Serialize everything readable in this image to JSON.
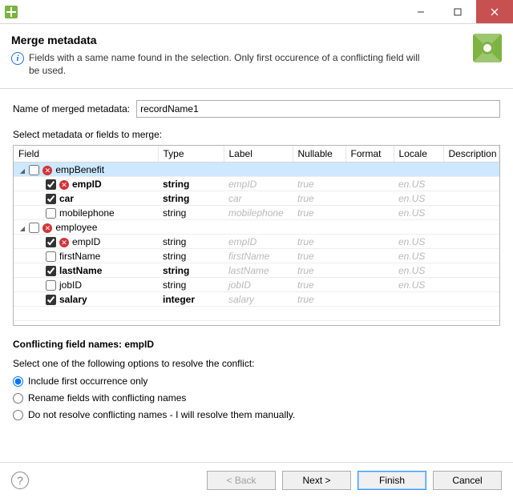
{
  "titlebar": {
    "title": ""
  },
  "banner": {
    "heading": "Merge metadata",
    "info": "Fields with a same name found in the selection. Only first occurence of a conflicting field will be used."
  },
  "nameField": {
    "label": "Name of merged metadata:",
    "value": "recordName1"
  },
  "selectLabel": "Select metadata or fields to merge:",
  "columns": {
    "field": "Field",
    "type": "Type",
    "label": "Label",
    "nullable": "Nullable",
    "format": "Format",
    "locale": "Locale",
    "description": "Description"
  },
  "groups": [
    {
      "name": "empBenefit",
      "checked": false,
      "conflict": true,
      "expanded": true,
      "selected": true,
      "children": [
        {
          "name": "empID",
          "type": "string",
          "label": "empID",
          "nullable": "true",
          "format": "",
          "locale": "en.US",
          "checked": true,
          "conflict": true,
          "bold": true
        },
        {
          "name": "car",
          "type": "string",
          "label": "car",
          "nullable": "true",
          "format": "",
          "locale": "en.US",
          "checked": true,
          "conflict": false,
          "bold": true
        },
        {
          "name": "mobilephone",
          "type": "string",
          "label": "mobilephone",
          "nullable": "true",
          "format": "",
          "locale": "en.US",
          "checked": false,
          "conflict": false,
          "bold": false
        }
      ]
    },
    {
      "name": "employee",
      "checked": false,
      "conflict": true,
      "expanded": true,
      "selected": false,
      "children": [
        {
          "name": "empID",
          "type": "string",
          "label": "empID",
          "nullable": "true",
          "format": "",
          "locale": "en.US",
          "checked": true,
          "conflict": true,
          "bold": false
        },
        {
          "name": "firstName",
          "type": "string",
          "label": "firstName",
          "nullable": "true",
          "format": "",
          "locale": "en.US",
          "checked": false,
          "conflict": false,
          "bold": false
        },
        {
          "name": "lastName",
          "type": "string",
          "label": "lastName",
          "nullable": "true",
          "format": "",
          "locale": "en.US",
          "checked": true,
          "conflict": false,
          "bold": true
        },
        {
          "name": "jobID",
          "type": "string",
          "label": "jobID",
          "nullable": "true",
          "format": "",
          "locale": "en.US",
          "checked": false,
          "conflict": false,
          "bold": false
        },
        {
          "name": "salary",
          "type": "integer",
          "label": "salary",
          "nullable": "true",
          "format": "",
          "locale": "",
          "checked": true,
          "conflict": false,
          "bold": true
        }
      ]
    }
  ],
  "conflict": {
    "title": "Conflicting field names: empID",
    "prompt": "Select one of the following options to resolve the conflict:",
    "options": [
      {
        "label": "Include first occurrence only",
        "checked": true
      },
      {
        "label": "Rename fields with conflicting names",
        "checked": false
      },
      {
        "label": "Do not resolve conflicting names - I will resolve them manually.",
        "checked": false
      }
    ]
  },
  "buttons": {
    "back": "< Back",
    "next": "Next >",
    "finish": "Finish",
    "cancel": "Cancel"
  }
}
